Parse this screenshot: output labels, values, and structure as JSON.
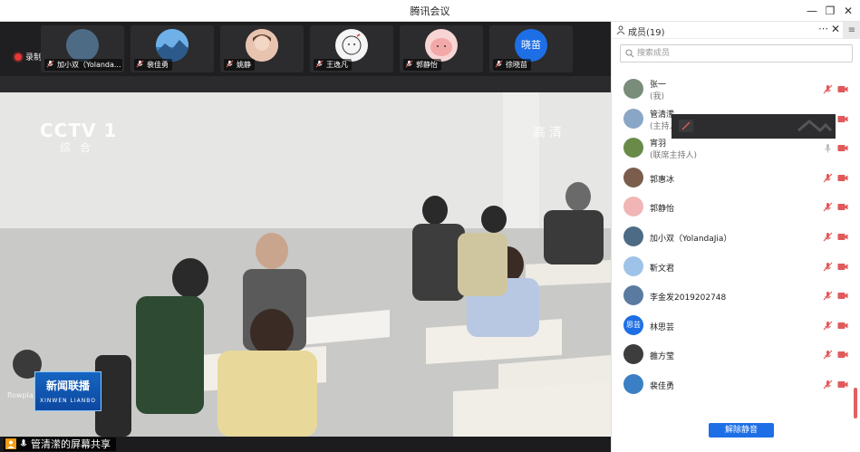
{
  "window": {
    "title": "腾讯会议"
  },
  "recording": {
    "label": "录制中"
  },
  "participants_strip": [
    {
      "name": "加小双（Yolanda...",
      "avatar_color": "#4e6b86",
      "avatar_text": ""
    },
    {
      "name": "裴佳勇",
      "avatar_color": "#3b7fc4",
      "avatar_text": ""
    },
    {
      "name": "姚静",
      "avatar_color": "#c98f7a",
      "avatar_text": ""
    },
    {
      "name": "王逸凡",
      "avatar_color": "#eeeeee",
      "avatar_text": ""
    },
    {
      "name": "郭静怡",
      "avatar_color": "#f1b5b5",
      "avatar_text": ""
    },
    {
      "name": "徐晓苗",
      "avatar_color": "#1e6fe6",
      "avatar_text": "晓苗"
    }
  ],
  "video": {
    "channel_logo": "CCTV 1",
    "channel_sub": "综合",
    "quality_badge": "高清",
    "news_logo_cn": "新闻联播",
    "news_logo_en": "XINWEN LIANBO",
    "player_watermark": "flowpla..."
  },
  "share": {
    "label": "管清潆的屏幕共享"
  },
  "panel": {
    "title": "成员(19)",
    "search_placeholder": "搜索成员",
    "unmute_all_label": "解除静音",
    "members": [
      {
        "name": "张一",
        "role": "(我)",
        "avatar_color": "#7a8c7a",
        "avatar_text": "",
        "mic": "muted"
      },
      {
        "name": "管清潆",
        "role": "(主持人)",
        "avatar_color": "#8aa6c7",
        "avatar_text": "",
        "mic": "muted"
      },
      {
        "name": "宵羽",
        "role": "(联席主持人)",
        "avatar_color": "#6a8a4a",
        "avatar_text": "",
        "mic": "on"
      },
      {
        "name": "郭惠冰",
        "role": "",
        "avatar_color": "#7b5d4d",
        "avatar_text": "",
        "mic": "muted"
      },
      {
        "name": "郭静怡",
        "role": "",
        "avatar_color": "#f1b5b5",
        "avatar_text": "",
        "mic": "muted"
      },
      {
        "name": "加小双（YolandaJia）",
        "role": "",
        "avatar_color": "#4e6b86",
        "avatar_text": "",
        "mic": "muted"
      },
      {
        "name": "靳文君",
        "role": "",
        "avatar_color": "#9fc3e8",
        "avatar_text": "",
        "mic": "muted"
      },
      {
        "name": "李金发2019202748",
        "role": "",
        "avatar_color": "#5a7aa0",
        "avatar_text": "",
        "mic": "muted"
      },
      {
        "name": "林思芸",
        "role": "",
        "avatar_color": "#1e6fe6",
        "avatar_text": "思芸",
        "mic": "muted"
      },
      {
        "name": "雒方莹",
        "role": "",
        "avatar_color": "#3d3d3d",
        "avatar_text": "",
        "mic": "muted"
      },
      {
        "name": "裴佳勇",
        "role": "",
        "avatar_color": "#3b7fc4",
        "avatar_text": "",
        "mic": "muted"
      }
    ]
  },
  "colors": {
    "accent": "#1e6fe6",
    "muted_red": "#e05a5a",
    "recording_red": "#e53935"
  }
}
